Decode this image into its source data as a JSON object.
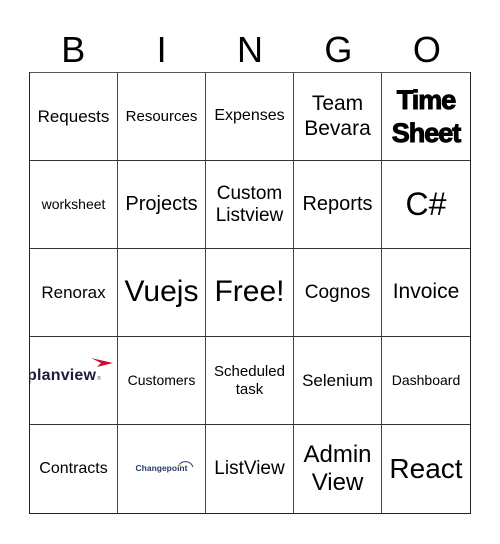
{
  "header": {
    "letters": [
      "B",
      "I",
      "N",
      "G",
      "O"
    ]
  },
  "cells": [
    {
      "text": "Requests",
      "size": "17px"
    },
    {
      "text": "Resources",
      "size": "15px"
    },
    {
      "text": "Expenses",
      "size": "16px"
    },
    {
      "text": "Team Bevara",
      "size": "21px"
    },
    {
      "text": "Time Sheet",
      "size": "27px",
      "style": "bold"
    },
    {
      "text": "worksheet",
      "size": "14px"
    },
    {
      "text": "Projects",
      "size": "20px"
    },
    {
      "text": "Custom Listview",
      "size": "19px"
    },
    {
      "text": "Reports",
      "size": "20px"
    },
    {
      "text": "C#",
      "size": "32px"
    },
    {
      "text": "Renorax",
      "size": "17px"
    },
    {
      "text": "Vuejs",
      "size": "30px"
    },
    {
      "text": "Free!",
      "size": "30px"
    },
    {
      "text": "Cognos",
      "size": "19px"
    },
    {
      "text": "Invoice",
      "size": "21px"
    },
    {
      "text": "planview",
      "type": "logo-planview",
      "accent": "#c8102e"
    },
    {
      "text": "Customers",
      "size": "14px"
    },
    {
      "text": "Scheduled task",
      "size": "15px"
    },
    {
      "text": "Selenium",
      "size": "17px"
    },
    {
      "text": "Dashboard",
      "size": "14px"
    },
    {
      "text": "Contracts",
      "size": "16px"
    },
    {
      "text": "Changepoint",
      "type": "logo-changepoint",
      "accent": "#2a3a6a"
    },
    {
      "text": "ListView",
      "size": "19px"
    },
    {
      "text": "Admin View",
      "size": "24px"
    },
    {
      "text": "React",
      "size": "28px"
    }
  ]
}
